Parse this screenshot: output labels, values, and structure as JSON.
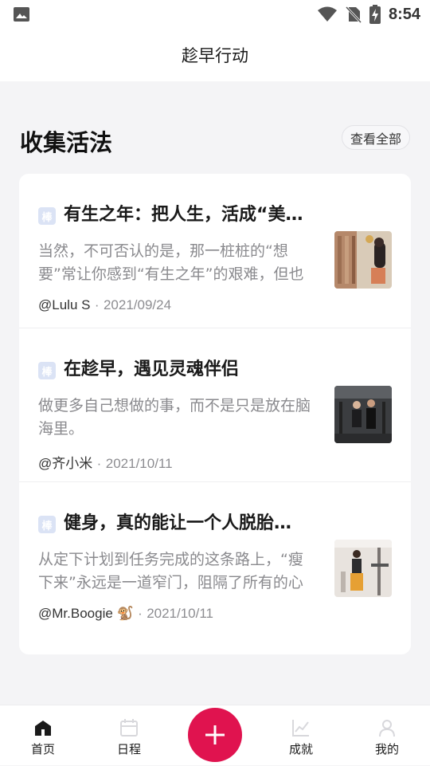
{
  "status_bar": {
    "time": "8:54",
    "icons": [
      "gallery-icon",
      "wifi-icon",
      "no-sim-icon",
      "battery-charging-icon"
    ]
  },
  "app_bar": {
    "title": "趁早行动"
  },
  "section": {
    "title": "收集活法",
    "view_all_label": "查看全部"
  },
  "articles": [
    {
      "tag": "棒",
      "title": "有生之年：把人生，活成“美…",
      "excerpt": "当然，不可否认的是，那一桩桩的“想要”常让你感到“有生之年”的艰难，但也",
      "author": "@Lulu S",
      "separator": "·",
      "date": "2021/09/24",
      "thumbnail": "woman-by-bookshelf-photo"
    },
    {
      "tag": "棒",
      "title": "在趁早，遇见灵魂伴侣",
      "excerpt": "做更多自己想做的事，而不是只是放在脑海里。",
      "author": "@齐小米",
      "separator": "·",
      "date": "2021/10/11",
      "thumbnail": "couple-at-gym-photo"
    },
    {
      "tag": "棒",
      "title": "健身，真的能让一个人脱胎…",
      "excerpt": "从定下计划到任务完成的这条路上，“瘦下来”永远是一道窄门，阻隔了所有的心",
      "author": "@Mr.Boogie 🐒",
      "separator": "·",
      "date": "2021/10/11",
      "thumbnail": "woman-lifting-at-gym-photo"
    }
  ],
  "tab_bar": {
    "items": [
      {
        "label": "首页",
        "icon": "home-icon",
        "active": true
      },
      {
        "label": "日程",
        "icon": "calendar-icon",
        "active": false
      },
      {
        "label": "成就",
        "icon": "chart-icon",
        "active": false
      },
      {
        "label": "我的",
        "icon": "profile-icon",
        "active": false
      }
    ],
    "fab_icon": "plus-icon"
  },
  "colors": {
    "accent": "#e0134f",
    "background": "#f4f4f6",
    "card": "#ffffff",
    "muted_text": "#8a8a8e",
    "tag_bg": "#dbe3f5"
  }
}
